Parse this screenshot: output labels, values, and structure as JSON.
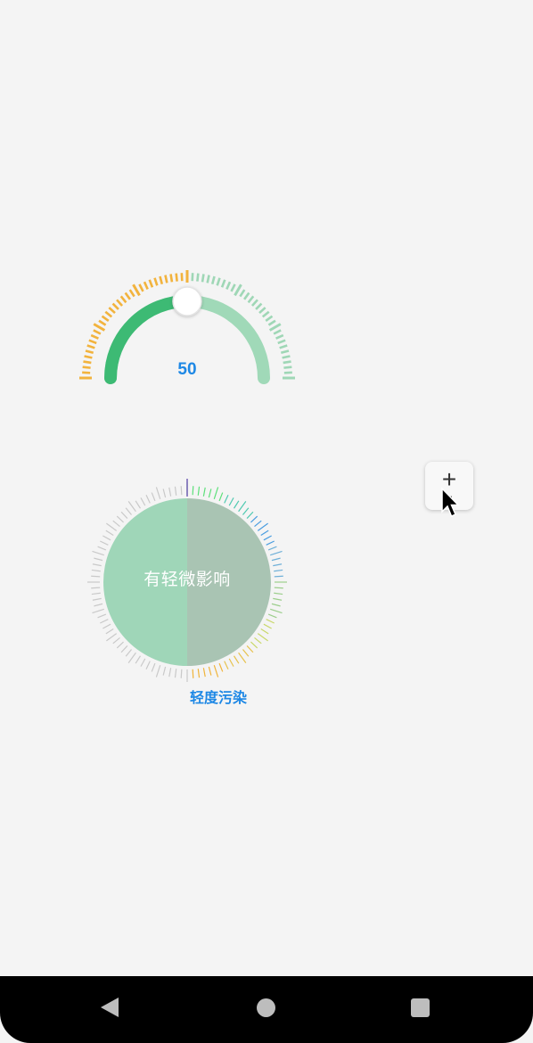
{
  "gauge": {
    "value": "50",
    "fraction": 0.5,
    "colors": {
      "active_arc": "#3dba74",
      "inactive_arc": "#a0d9b8",
      "active_ticks": "#f2b33d",
      "inactive_ticks": "#9fd7b6",
      "handle": "#ffffff"
    }
  },
  "dial": {
    "center_text": "有轻微影响",
    "level_label": "轻度污染",
    "fraction": 0.5,
    "colors": {
      "left_fill": "#9fd6b8",
      "right_fill": "#a9c4b3",
      "pointer": "#7a68b8",
      "inactive_ticks": "#c9c9c9"
    }
  },
  "fab": {
    "plus": "+",
    "minus": "-"
  },
  "navbar": {
    "back_icon": "back-triangle",
    "home_icon": "home-circle",
    "recents_icon": "recents-square"
  }
}
